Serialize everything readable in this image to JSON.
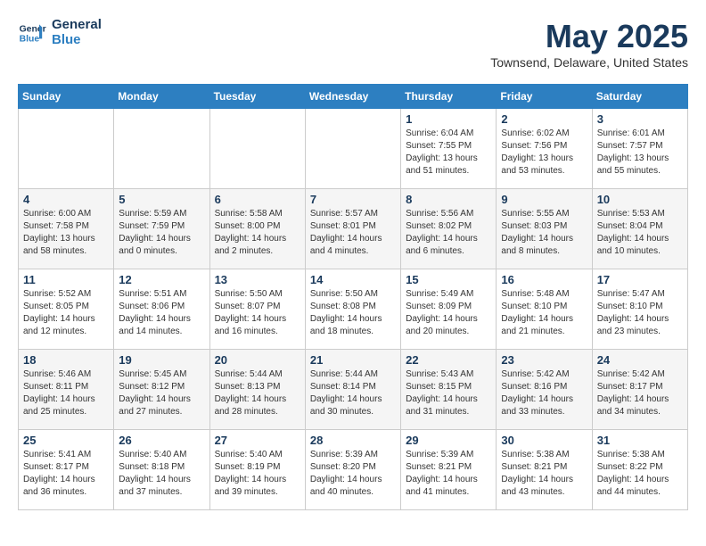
{
  "logo": {
    "line1": "General",
    "line2": "Blue"
  },
  "title": "May 2025",
  "location": "Townsend, Delaware, United States",
  "days_of_week": [
    "Sunday",
    "Monday",
    "Tuesday",
    "Wednesday",
    "Thursday",
    "Friday",
    "Saturday"
  ],
  "weeks": [
    [
      {
        "num": "",
        "info": ""
      },
      {
        "num": "",
        "info": ""
      },
      {
        "num": "",
        "info": ""
      },
      {
        "num": "",
        "info": ""
      },
      {
        "num": "1",
        "info": "Sunrise: 6:04 AM\nSunset: 7:55 PM\nDaylight: 13 hours\nand 51 minutes."
      },
      {
        "num": "2",
        "info": "Sunrise: 6:02 AM\nSunset: 7:56 PM\nDaylight: 13 hours\nand 53 minutes."
      },
      {
        "num": "3",
        "info": "Sunrise: 6:01 AM\nSunset: 7:57 PM\nDaylight: 13 hours\nand 55 minutes."
      }
    ],
    [
      {
        "num": "4",
        "info": "Sunrise: 6:00 AM\nSunset: 7:58 PM\nDaylight: 13 hours\nand 58 minutes."
      },
      {
        "num": "5",
        "info": "Sunrise: 5:59 AM\nSunset: 7:59 PM\nDaylight: 14 hours\nand 0 minutes."
      },
      {
        "num": "6",
        "info": "Sunrise: 5:58 AM\nSunset: 8:00 PM\nDaylight: 14 hours\nand 2 minutes."
      },
      {
        "num": "7",
        "info": "Sunrise: 5:57 AM\nSunset: 8:01 PM\nDaylight: 14 hours\nand 4 minutes."
      },
      {
        "num": "8",
        "info": "Sunrise: 5:56 AM\nSunset: 8:02 PM\nDaylight: 14 hours\nand 6 minutes."
      },
      {
        "num": "9",
        "info": "Sunrise: 5:55 AM\nSunset: 8:03 PM\nDaylight: 14 hours\nand 8 minutes."
      },
      {
        "num": "10",
        "info": "Sunrise: 5:53 AM\nSunset: 8:04 PM\nDaylight: 14 hours\nand 10 minutes."
      }
    ],
    [
      {
        "num": "11",
        "info": "Sunrise: 5:52 AM\nSunset: 8:05 PM\nDaylight: 14 hours\nand 12 minutes."
      },
      {
        "num": "12",
        "info": "Sunrise: 5:51 AM\nSunset: 8:06 PM\nDaylight: 14 hours\nand 14 minutes."
      },
      {
        "num": "13",
        "info": "Sunrise: 5:50 AM\nSunset: 8:07 PM\nDaylight: 14 hours\nand 16 minutes."
      },
      {
        "num": "14",
        "info": "Sunrise: 5:50 AM\nSunset: 8:08 PM\nDaylight: 14 hours\nand 18 minutes."
      },
      {
        "num": "15",
        "info": "Sunrise: 5:49 AM\nSunset: 8:09 PM\nDaylight: 14 hours\nand 20 minutes."
      },
      {
        "num": "16",
        "info": "Sunrise: 5:48 AM\nSunset: 8:10 PM\nDaylight: 14 hours\nand 21 minutes."
      },
      {
        "num": "17",
        "info": "Sunrise: 5:47 AM\nSunset: 8:10 PM\nDaylight: 14 hours\nand 23 minutes."
      }
    ],
    [
      {
        "num": "18",
        "info": "Sunrise: 5:46 AM\nSunset: 8:11 PM\nDaylight: 14 hours\nand 25 minutes."
      },
      {
        "num": "19",
        "info": "Sunrise: 5:45 AM\nSunset: 8:12 PM\nDaylight: 14 hours\nand 27 minutes."
      },
      {
        "num": "20",
        "info": "Sunrise: 5:44 AM\nSunset: 8:13 PM\nDaylight: 14 hours\nand 28 minutes."
      },
      {
        "num": "21",
        "info": "Sunrise: 5:44 AM\nSunset: 8:14 PM\nDaylight: 14 hours\nand 30 minutes."
      },
      {
        "num": "22",
        "info": "Sunrise: 5:43 AM\nSunset: 8:15 PM\nDaylight: 14 hours\nand 31 minutes."
      },
      {
        "num": "23",
        "info": "Sunrise: 5:42 AM\nSunset: 8:16 PM\nDaylight: 14 hours\nand 33 minutes."
      },
      {
        "num": "24",
        "info": "Sunrise: 5:42 AM\nSunset: 8:17 PM\nDaylight: 14 hours\nand 34 minutes."
      }
    ],
    [
      {
        "num": "25",
        "info": "Sunrise: 5:41 AM\nSunset: 8:17 PM\nDaylight: 14 hours\nand 36 minutes."
      },
      {
        "num": "26",
        "info": "Sunrise: 5:40 AM\nSunset: 8:18 PM\nDaylight: 14 hours\nand 37 minutes."
      },
      {
        "num": "27",
        "info": "Sunrise: 5:40 AM\nSunset: 8:19 PM\nDaylight: 14 hours\nand 39 minutes."
      },
      {
        "num": "28",
        "info": "Sunrise: 5:39 AM\nSunset: 8:20 PM\nDaylight: 14 hours\nand 40 minutes."
      },
      {
        "num": "29",
        "info": "Sunrise: 5:39 AM\nSunset: 8:21 PM\nDaylight: 14 hours\nand 41 minutes."
      },
      {
        "num": "30",
        "info": "Sunrise: 5:38 AM\nSunset: 8:21 PM\nDaylight: 14 hours\nand 43 minutes."
      },
      {
        "num": "31",
        "info": "Sunrise: 5:38 AM\nSunset: 8:22 PM\nDaylight: 14 hours\nand 44 minutes."
      }
    ]
  ]
}
